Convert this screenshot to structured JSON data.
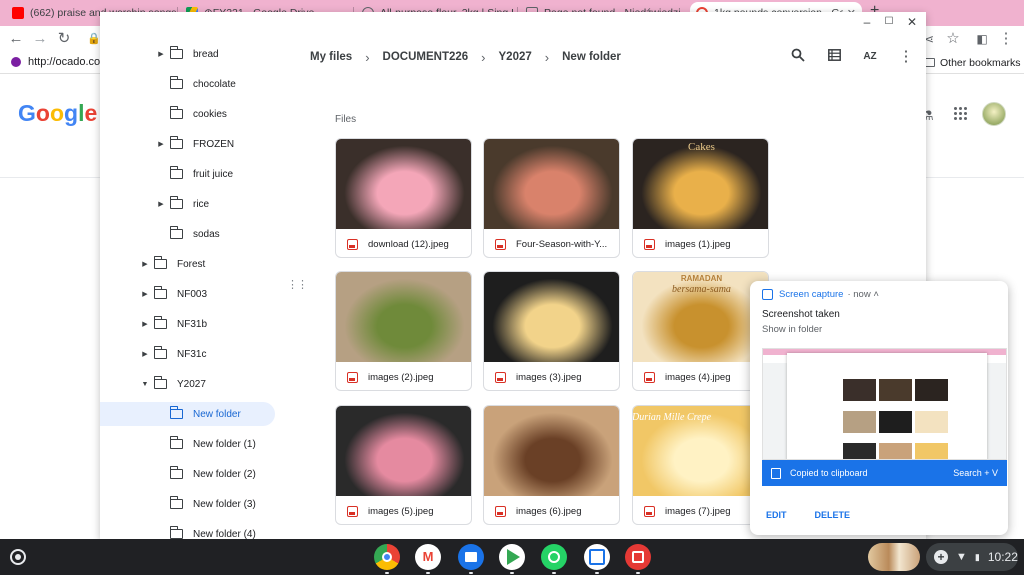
{
  "browser": {
    "tabs": [
      {
        "title": "(662) praise and worship songs",
        "color": "#ff0000"
      },
      {
        "title": "⊕FY221 - Google Drive",
        "color": "#fbbc04"
      },
      {
        "title": "All-purpose flour, 2kg | Sing H",
        "color": "#5f6368"
      },
      {
        "title": "Page not found - Niedźwiedzi",
        "color": "#5f6368"
      },
      {
        "title": "1kg pounds conversion - Goo",
        "color": "#ea4335",
        "active": true
      }
    ],
    "new_tab_label": "+",
    "bookmark_url": "http://ocado.com",
    "other_bookmarks": "Other bookmarks",
    "google_logo": [
      "G",
      "o",
      "o",
      "g",
      "l",
      "e"
    ]
  },
  "files_app": {
    "breadcrumb": [
      "My files",
      "DOCUMENT226",
      "Y2027",
      "New folder"
    ],
    "section_label": "Files",
    "tree": [
      {
        "label": "bread",
        "depth": 2,
        "arrow": true,
        "expanded": false
      },
      {
        "label": "chocolate",
        "depth": 2,
        "arrow": false
      },
      {
        "label": "cookies",
        "depth": 2,
        "arrow": false
      },
      {
        "label": "FROZEN",
        "depth": 2,
        "arrow": true,
        "expanded": false
      },
      {
        "label": "fruit juice",
        "depth": 2,
        "arrow": false
      },
      {
        "label": "rice",
        "depth": 2,
        "arrow": true,
        "expanded": false
      },
      {
        "label": "sodas",
        "depth": 2,
        "arrow": false
      },
      {
        "label": "Forest",
        "depth": 1,
        "arrow": true,
        "expanded": false
      },
      {
        "label": "NF003",
        "depth": 1,
        "arrow": true,
        "expanded": false
      },
      {
        "label": "NF31b",
        "depth": 1,
        "arrow": true,
        "expanded": false
      },
      {
        "label": "NF31c",
        "depth": 1,
        "arrow": true,
        "expanded": false
      },
      {
        "label": "Y2027",
        "depth": 1,
        "arrow": true,
        "expanded": true
      },
      {
        "label": "New folder",
        "depth": 2,
        "arrow": false,
        "selected": true
      },
      {
        "label": "New folder (1)",
        "depth": 2,
        "arrow": false
      },
      {
        "label": "New folder (2)",
        "depth": 2,
        "arrow": false
      },
      {
        "label": "New folder (3)",
        "depth": 2,
        "arrow": false
      },
      {
        "label": "New folder (4)",
        "depth": 2,
        "arrow": false
      }
    ],
    "files": [
      {
        "name": "download (12).jpeg",
        "bg": "#3a2f2a",
        "accent": "#f4a6b8"
      },
      {
        "name": "Four-Season-with-Y...",
        "bg": "#4a3a2c",
        "accent": "#d9826b"
      },
      {
        "name": "images (1).jpeg",
        "bg": "#2b2420",
        "accent": "#e9b04a"
      },
      {
        "name": "images (2).jpeg",
        "bg": "#b6a083",
        "accent": "#6f8a3a"
      },
      {
        "name": "images (3).jpeg",
        "bg": "#1e1e1e",
        "accent": "#f2d38a"
      },
      {
        "name": "images (4).jpeg",
        "bg": "#f3e2c0",
        "accent": "#c8912e"
      },
      {
        "name": "images (5).jpeg",
        "bg": "#2a2a2a",
        "accent": "#e58aa0"
      },
      {
        "name": "images (6).jpeg",
        "bg": "#c9a27a",
        "accent": "#6a4026"
      },
      {
        "name": "images (7).jpeg",
        "bg": "#f1c766",
        "accent": "#fff2c4"
      }
    ],
    "overlay_texts": {
      "tile3": "Cakes",
      "tile6_top": "RAMADAN",
      "tile6_mid": "bersama-sama",
      "tile9": "Durian Mille Crepe"
    }
  },
  "notification": {
    "app": "Screen capture",
    "time": "now",
    "title": "Screenshot taken",
    "subtitle": "Show in folder",
    "clipboard": "Copied to clipboard",
    "shortcut": "Search + V",
    "actions": [
      "EDIT",
      "DELETE"
    ]
  },
  "shelf": {
    "time": "10:22",
    "apps": [
      {
        "name": "chrome",
        "color": "#4285f4"
      },
      {
        "name": "gmail",
        "color": "#ea4335"
      },
      {
        "name": "files",
        "color": "#1a73e8"
      },
      {
        "name": "play-store",
        "color": "#34a853"
      },
      {
        "name": "whatsapp",
        "color": "#25d366"
      },
      {
        "name": "calendar",
        "color": "#1a73e8"
      },
      {
        "name": "screencast",
        "color": "#e53935"
      }
    ]
  }
}
